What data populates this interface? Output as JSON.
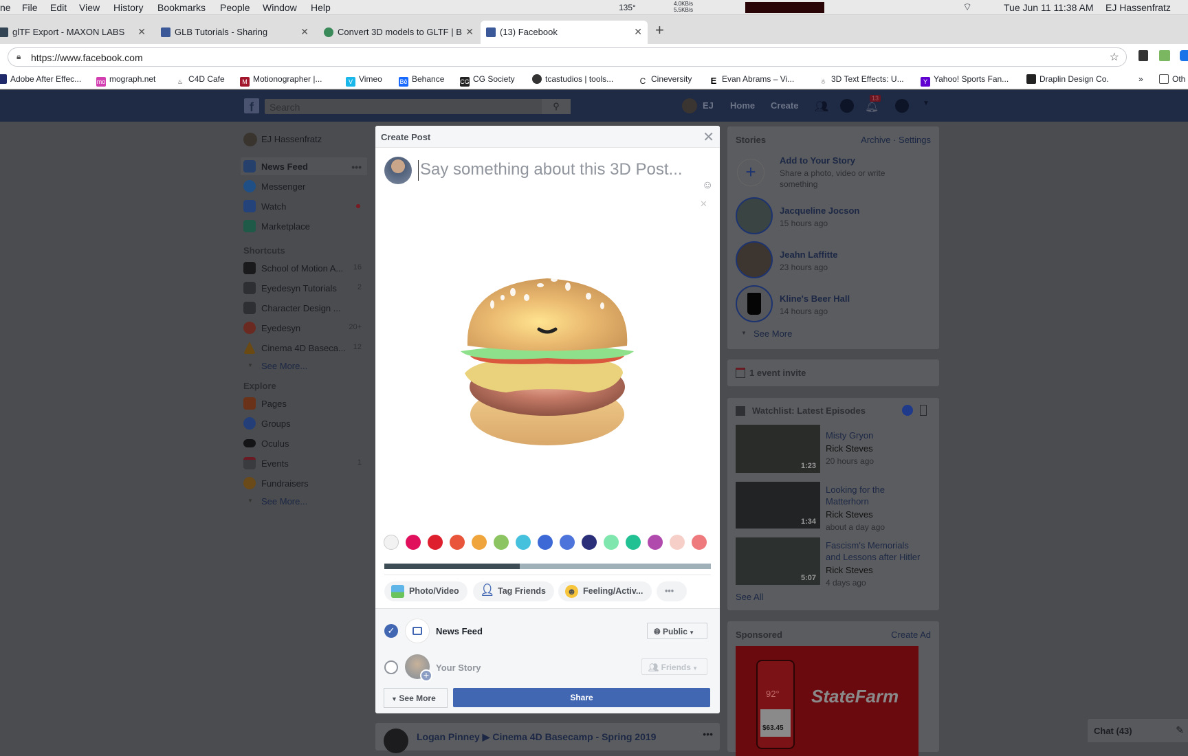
{
  "os_menu": {
    "app": "ne",
    "items": [
      "File",
      "Edit",
      "View",
      "History",
      "Bookmarks",
      "People",
      "Window",
      "Help"
    ],
    "temp": "135°",
    "net_up": "4.0KB/s",
    "net_down": "5.5KB/s",
    "clock": "Tue Jun 11  11:38 AM",
    "user": "EJ Hassenfratz"
  },
  "browser": {
    "tabs": [
      {
        "title": "glTF Export - MAXON LABS"
      },
      {
        "title": "GLB Tutorials - Sharing"
      },
      {
        "title": "Convert 3D models to GLTF | B"
      },
      {
        "title": "(13) Facebook",
        "active": true
      }
    ],
    "url": "https://www.facebook.com",
    "bookmarks": [
      "Adobe After Effec...",
      "mograph.net",
      "C4D Cafe",
      "Motionographer |...",
      "Vimeo",
      "Behance",
      "CG Society",
      "tcastudios | tools...",
      "Cineversity",
      "Evan Abrams – Vi...",
      "3D Text Effects: U...",
      "Yahoo! Sports Fan...",
      "Draplin Design Co.",
      "»",
      "Oth"
    ]
  },
  "fb_header": {
    "search_placeholder": "Search",
    "user": "EJ",
    "home": "Home",
    "create": "Create",
    "notifications": "13"
  },
  "sidebar": {
    "user": "EJ Hassenfratz",
    "main": [
      {
        "label": "News Feed"
      },
      {
        "label": "Messenger"
      },
      {
        "label": "Watch"
      },
      {
        "label": "Marketplace"
      }
    ],
    "shortcuts_title": "Shortcuts",
    "shortcuts": [
      {
        "label": "School of Motion A...",
        "count": "16"
      },
      {
        "label": "Eyedesyn Tutorials",
        "count": "2"
      },
      {
        "label": "Character Design ...",
        "count": ""
      },
      {
        "label": "Eyedesyn",
        "count": "20+"
      },
      {
        "label": "Cinema 4D Baseca...",
        "count": "12"
      }
    ],
    "see_more": "See More...",
    "explore_title": "Explore",
    "explore": [
      {
        "label": "Pages",
        "count": ""
      },
      {
        "label": "Groups",
        "count": ""
      },
      {
        "label": "Oculus",
        "count": ""
      },
      {
        "label": "Events",
        "count": "1"
      },
      {
        "label": "Fundraisers",
        "count": ""
      }
    ]
  },
  "modal": {
    "title": "Create Post",
    "placeholder": "Say something about this 3D Post...",
    "colors": [
      "#f2f2f2",
      "#e0105c",
      "#dd1f2e",
      "#e8553a",
      "#f0a53c",
      "#8cc461",
      "#45c1dd",
      "#3d69d6",
      "#4d74db",
      "#2b2f7a",
      "#7fe6ad",
      "#21c194",
      "#b04aad",
      "#f6d0c8",
      "#ef7a7e"
    ],
    "progress_percent": 41.5,
    "actions": [
      "Photo/Video",
      "Tag Friends",
      "Feeling/Activ...",
      "•••"
    ],
    "news_feed": "News Feed",
    "public": "Public",
    "your_story": "Your Story",
    "friends": "Friends",
    "see_more": "See More",
    "share": "Share",
    "accent": "#4267b2"
  },
  "feed_post": {
    "text": "Logan Pinney ▶ Cinema 4D Basecamp - Spring 2019"
  },
  "right": {
    "stories_title": "Stories",
    "archive": "Archive · Settings",
    "add_story": {
      "title": "Add to Your Story",
      "desc1": "Share a photo, video or write",
      "desc2": "something"
    },
    "stories": [
      {
        "name": "Jacqueline Jocson",
        "time": "15 hours ago"
      },
      {
        "name": "Jeahn Laffitte",
        "time": "23 hours ago"
      },
      {
        "name": "Kline's Beer Hall",
        "time": "14 hours ago"
      }
    ],
    "see_more": "See More",
    "event_invite": "1 event invite",
    "watchlist_title": "Watchlist: Latest Episodes",
    "episodes": [
      {
        "title1": "Misty Gryon",
        "title2": "",
        "author": "Rick Steves",
        "time": "20 hours ago",
        "duration": "1:23"
      },
      {
        "title1": "Looking for the",
        "title2": "Matterhorn",
        "author": "Rick Steves",
        "time": "about a day ago",
        "duration": "1:34"
      },
      {
        "title1": "Fascism's Memorials",
        "title2": "and Lessons after Hitler",
        "author": "Rick Steves",
        "time": "4 days ago",
        "duration": "5:07"
      }
    ],
    "see_all": "See All",
    "sponsored": "Sponsored",
    "create_ad": "Create Ad",
    "ad": {
      "brand": "StateFarm",
      "temp": "92°",
      "price": "$63.45"
    }
  },
  "chat": {
    "label": "Chat (43)"
  }
}
